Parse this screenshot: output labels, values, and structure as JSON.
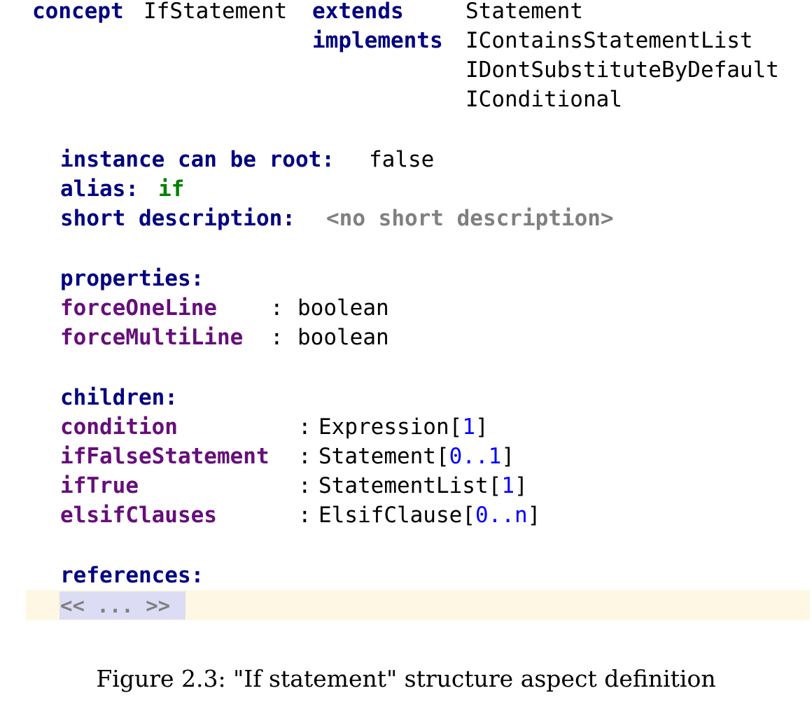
{
  "concept": {
    "keyword": "concept",
    "name": "IfStatement",
    "extends_keyword": "extends",
    "extends_value": "Statement",
    "implements_keyword": "implements",
    "interfaces": [
      "IContainsStatementList",
      "IDontSubstituteByDefault",
      "IConditional"
    ]
  },
  "header": {
    "root_label": "instance can be root",
    "root_value": "false",
    "alias_label": "alias",
    "alias_value": "if",
    "short_description_label": "short description",
    "short_description_value": "<no short description>"
  },
  "properties": {
    "label": "properties:",
    "items": [
      {
        "name": "forceOneLine",
        "type": "boolean"
      },
      {
        "name": "forceMultiLine",
        "type": "boolean"
      }
    ]
  },
  "children": {
    "label": "children:",
    "items": [
      {
        "name": "condition",
        "type": "Expression",
        "cardinality": "1"
      },
      {
        "name": "ifFalseStatement",
        "type": "Statement",
        "cardinality": "0..1"
      },
      {
        "name": "ifTrue",
        "type": "StatementList",
        "cardinality": "1"
      },
      {
        "name": "elsifClauses",
        "type": "ElsifClause",
        "cardinality": "0..n"
      }
    ]
  },
  "references": {
    "label": "references:",
    "placeholder": "<< ... >>"
  },
  "caption": "Figure 2.3: \"If statement\" structure aspect definition",
  "colors": {
    "keyword": "#000080",
    "property": "#660e7a",
    "alias": "#008000",
    "placeholder": "#808080",
    "number": "#0000ff",
    "current_line_bg": "#fdf7e4",
    "placeholder_bg": "#dcdcf4"
  }
}
